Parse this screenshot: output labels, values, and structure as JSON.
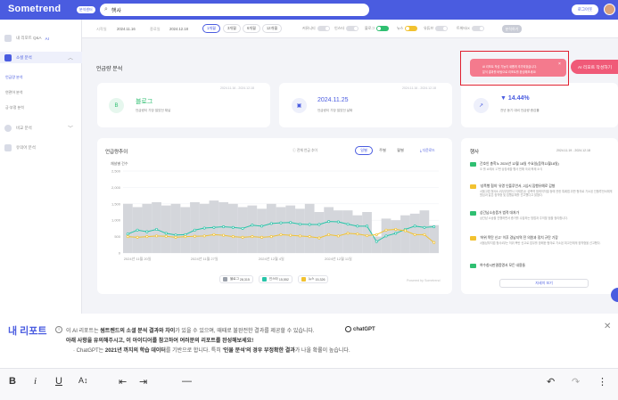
{
  "header": {
    "logo": "Sometrend",
    "logo_badge": "분석센터",
    "search_value": "행사",
    "btn_label": "로그아웃"
  },
  "sidebar": {
    "items": [
      {
        "label": "내 리포트 Q&A",
        "badge": "AI"
      },
      {
        "label": "소셜 분석"
      },
      {
        "label": "비교 분석"
      },
      {
        "label": "유의어 분석"
      }
    ],
    "subs": [
      "언급량 분석",
      "연관어 분석",
      "긍·부정 분석"
    ]
  },
  "filters": {
    "start_label": "시작일",
    "start": "2024.11.16",
    "end_label": "종료일",
    "end": "2024.12.18",
    "periods": [
      "1개월",
      "3개월",
      "6개월",
      "12개월"
    ],
    "toggles": [
      "커뮤니티",
      "인스타",
      "블로그",
      "뉴스",
      "유튜브",
      "트위터/X",
      "네이버카페"
    ],
    "apply": "분석하기"
  },
  "main": {
    "title": "언급량 분석",
    "cards": [
      {
        "date": "2024.11.16 - 2024.12.18",
        "icon": "B",
        "main": "블로그",
        "sub": "언급량이 가장 많았던 채널"
      },
      {
        "date": "2024.11.16 - 2024.12.18",
        "icon": "▣",
        "main": "2024.11.25",
        "sub": "언급량이 가장 많았던 날짜"
      },
      {
        "date": "2024.11.16 - 2024.12.18",
        "icon": "↗",
        "main": "▼ 14.44%",
        "sub": "전년 동기 대비 언급량 증감률"
      }
    ]
  },
  "chart_data": {
    "type": "bar",
    "title": "언급량추이",
    "unit_label": "채널별 건수",
    "toggle_label": "전체 언급 추이",
    "periods": [
      "일별",
      "주별",
      "월별"
    ],
    "download": "다운로드",
    "ylim": [
      0,
      2500
    ],
    "yticks": [
      "2,500",
      "2,000",
      "1,500",
      "1,000",
      "500",
      "0"
    ],
    "xticks": [
      "2024년 11월 20일",
      "2024년 11월 27일",
      "2024년 12월 4일",
      "2024년 12월 11일"
    ],
    "watermark": "Powered by Sometrend",
    "bars": [
      1500,
      1400,
      1500,
      1550,
      1450,
      1500,
      1400,
      1550,
      1500,
      1600,
      1550,
      1500,
      1400,
      1450,
      1350,
      1500,
      1400,
      1450,
      1350,
      1500,
      1250,
      1400,
      1300,
      1300,
      1150,
      1250,
      500,
      1050,
      1000,
      1150,
      1200,
      1300,
      850
    ],
    "series": [
      {
        "name": "블로그",
        "total": "28,315",
        "color": "#9aa0aa",
        "values": [
          1500,
          1400,
          1500,
          1550,
          1450,
          1500,
          1400,
          1550,
          1500,
          1600,
          1550,
          1500,
          1400,
          1450,
          1350,
          1500,
          1400,
          1450,
          1350,
          1500,
          1250,
          1400,
          1300,
          1300,
          1150,
          1250,
          500,
          1050,
          1000,
          1150,
          1200,
          1300,
          850
        ]
      },
      {
        "name": "인스타",
        "total": "15,552",
        "color": "#27c4a8",
        "values": [
          580,
          700,
          650,
          720,
          600,
          550,
          560,
          700,
          760,
          780,
          800,
          780,
          750,
          850,
          820,
          900,
          920,
          930,
          880,
          870,
          870,
          960,
          950,
          880,
          820,
          820,
          350,
          520,
          600,
          720,
          820,
          780,
          800
        ]
      },
      {
        "name": "뉴스",
        "total": "15,326",
        "color": "#f2c230",
        "values": [
          500,
          480,
          500,
          520,
          510,
          480,
          500,
          510,
          520,
          560,
          540,
          500,
          480,
          500,
          480,
          500,
          560,
          540,
          520,
          500,
          460,
          560,
          520,
          600,
          580,
          530,
          560,
          700,
          720,
          680,
          560,
          560,
          320
        ]
      }
    ]
  },
  "issues": {
    "title": "행사",
    "date": "2024.11.19 - 2024.12.18",
    "more": "자세히 보기",
    "items": [
      {
        "tag": "news",
        "color": "#2fbf71",
        "title": "간호인 총학노 2024년 12월 18일 수요일(음력11월18일)",
        "desc": "오 롤 쇼에서 17번 상장세출 행사 전해 국내 축제 소식"
      },
      {
        "tag": "news",
        "color": "#f2c230",
        "title": "'성폭행 협의' 유명 인플루언서, 2심서 집행유예로 감형",
        "desc": "서울고법 형사8-1부(부장판사 이재권)는 성폭력 범죄의처벌 등에 관한 특례법 위반 혐의로 기소된 인플루언서에게 원심과 같은 징역형 및 집행유예를 선고했다고 밝혔다."
      },
      {
        "tag": "news",
        "color": "#2fbf71",
        "title": "상간남소송증거 법적 대처가",
        "desc": "상간남 소송을 진행하면서 증거를 수집하는 방법과 주의할 점을 정리합니다."
      },
      {
        "tag": "news",
        "color": "#f2c230",
        "title": "'허위 폭탄 신고' 이후 경남지역 전 의원과 정치 규탄 기장",
        "desc": "서울남부지법 형사4부는 허위 폭탄 신고로 업무를 방해한 혐의로 기소된 피고인에게 징역형을 선고했다."
      },
      {
        "tag": "news",
        "color": "#2fbf71",
        "title": "여수창시판결증명서 모든 내용들",
        "desc": ""
      }
    ]
  },
  "popup": {
    "lines": [
      "AI 리포트 작성 기능이 새롭게 추가되었습니다.",
      "분석 결과를 바탕으로 리포트를 완성해보세요!"
    ],
    "ai_btn": "AI 리포트 작성하기"
  },
  "report": {
    "title": "내 리포트",
    "line1_a": "이 AI 리포트는 ",
    "line1_b": "썸트렌드의 소셜 분석 결과와 차이",
    "line1_c": "가 있을 수 있으며, 때때로 불완전한 결과를 제공할 수 있습니다.",
    "gpt": "chatGPT",
    "line2": "아래 사항을 유의해주시고, 이 아이디어를 참고하여 여러분의 리포트를 완성해보세요!",
    "line3_a": "· ChatGPT는 ",
    "line3_b": "2021년 까지의 학습 데이터",
    "line3_c": "를 기반으로 합니다. 특히 ",
    "line3_d": "'인물 분석'의 경우 부정확한 결과",
    "line3_e": "가 나올 확률이 높습니다."
  },
  "toolbar": {
    "bold": "B",
    "italic": "i",
    "underline": "U",
    "fontsize": "A↕",
    "outdent": "⇤",
    "indent": "⇥",
    "hr": "—",
    "undo": "↶",
    "redo": "↷",
    "more": "⋮"
  }
}
